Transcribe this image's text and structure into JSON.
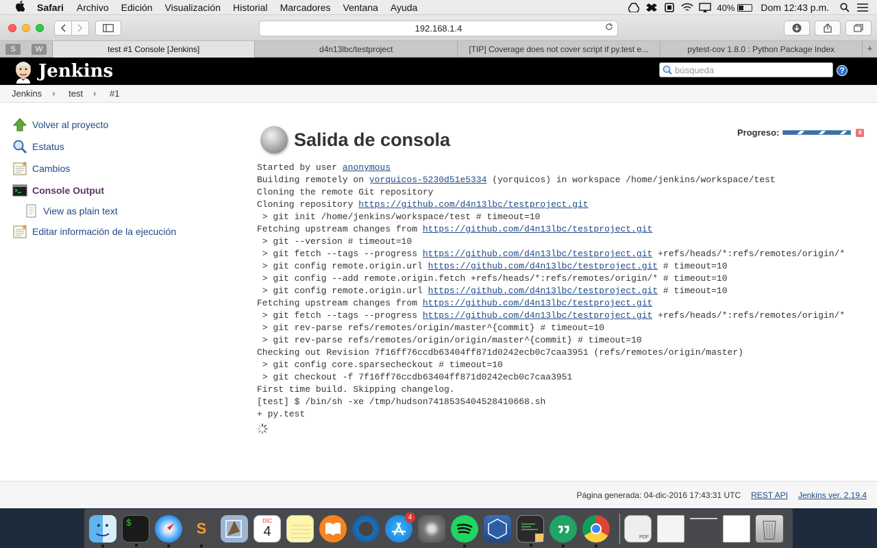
{
  "menubar": {
    "apple": "",
    "items": [
      "Safari",
      "Archivo",
      "Edición",
      "Visualización",
      "Historial",
      "Marcadores",
      "Ventana",
      "Ayuda"
    ],
    "battery_percent": "40%",
    "battery_level": 0.4,
    "clock": "Dom 12:43 p.m."
  },
  "browser": {
    "address": "192.168.1.4",
    "pinned": [
      "S",
      "W"
    ],
    "tabs": [
      {
        "title": "test #1 Console [Jenkins]",
        "active": true
      },
      {
        "title": "d4n13lbc/testproject",
        "active": false
      },
      {
        "title": "[TIP] Coverage does not cover script if py.test e...",
        "active": false
      },
      {
        "title": "pytest-cov 1.8.0 : Python Package Index",
        "active": false
      }
    ],
    "new_tab": "+"
  },
  "jenkins": {
    "brand": "Jenkins",
    "search_placeholder": "búsqueda",
    "help": "?",
    "breadcrumbs": [
      "Jenkins",
      "test",
      "#1"
    ],
    "sidebar": [
      {
        "label": "Volver al proyecto",
        "icon": "up-arrow-icon"
      },
      {
        "label": "Estatus",
        "icon": "search-icon"
      },
      {
        "label": "Cambios",
        "icon": "notepad-icon"
      },
      {
        "label": "Console Output",
        "icon": "terminal-icon"
      },
      {
        "label": "View as plain text",
        "icon": "document-icon"
      },
      {
        "label": "Editar información de la ejecución",
        "icon": "notepad-icon"
      }
    ],
    "page_title": "Salida de consola",
    "progress_label": "Progreso:",
    "progress_stop": "x",
    "console": {
      "user_prefix": "Started by user ",
      "user": "anonymous",
      "building_prefix": "Building remotely on ",
      "node": "yorquicos-5230d51e5334",
      "building_suffix": " (yorquicos) in workspace /home/jenkins/workspace/test",
      "repo_url": "https://github.com/d4n13lbc/testproject.git",
      "lines": {
        "clone_remote": "Cloning the remote Git repository",
        "cloning_repo": "Cloning repository ",
        "git_init": " > git init /home/jenkins/workspace/test # timeout=10",
        "fetching": "Fetching upstream changes from ",
        "git_version": " > git --version # timeout=10",
        "fetch_prefix": " > git fetch --tags --progress ",
        "fetch_suffix": " +refs/heads/*:refs/remotes/origin/*",
        "config_url_prefix": " > git config remote.origin.url ",
        "config_url_suffix": " # timeout=10",
        "config_add": " > git config --add remote.origin.fetch +refs/heads/*:refs/remotes/origin/* # timeout=10",
        "rev_parse_1": " > git rev-parse refs/remotes/origin/master^{commit} # timeout=10",
        "rev_parse_2": " > git rev-parse refs/remotes/origin/origin/master^{commit} # timeout=10",
        "checkout_rev": "Checking out Revision 7f16ff76ccdb63404ff871d0242ecb0c7caa3951 (refs/remotes/origin/master)",
        "sparse": " > git config core.sparsecheckout # timeout=10",
        "checkout": " > git checkout -f 7f16ff76ccdb63404ff871d0242ecb0c7caa3951",
        "first_build": "First time build. Skipping changelog.",
        "shell": "[test] $ /bin/sh -xe /tmp/hudson7418535404528410668.sh",
        "pytest": "+ py.test"
      }
    },
    "footer": {
      "generated": "Página generada: 04-dic-2016 17:43:31 UTC",
      "rest_api": "REST API",
      "version": "Jenkins ver. 2.19.4"
    }
  },
  "dock": {
    "calendar_month": "DIC",
    "calendar_day": "4",
    "app_store_badge": "4",
    "terminal_glyph": "$",
    "sublime_glyph": "S",
    "pdf_label": "PDF"
  },
  "colors": {
    "jenkins_link": "#204a87",
    "jenkins_visited": "#5c3566",
    "header_bg": "#000000"
  }
}
